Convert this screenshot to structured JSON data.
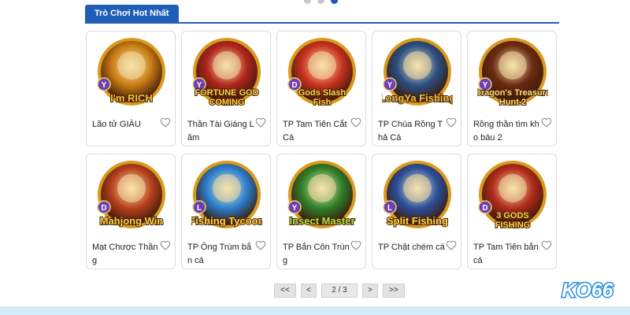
{
  "carousel": {
    "dots": 3,
    "active": 2
  },
  "section": {
    "title": "Trò Chơi Hot Nhất"
  },
  "games": [
    {
      "name": "Lão tử GIÀU",
      "art": "I'm RICH",
      "badge": "Y",
      "color": "#f2c33a",
      "bg": "#c77a12"
    },
    {
      "name": "Thần Tài Giáng Lâm",
      "art": "FORTUNE GOD COMING",
      "badge": "Y",
      "color": "#ffd84a",
      "bg": "#b0251c"
    },
    {
      "name": "TP Tam Tiên Cắt Cá",
      "art": "Gods Slash Fish",
      "badge": "D",
      "color": "#ffd84a",
      "bg": "#c9321e"
    },
    {
      "name": "TP Chúa Rồng Thả Cá",
      "art": "LongYa Fishing",
      "badge": "Y",
      "color": "#e9c24a",
      "bg": "#2c4f84"
    },
    {
      "name": "Rồng thần tìm kho báu 2",
      "art": "Dragon's Treasure Hunt 2",
      "badge": "Y",
      "color": "#ffe27a",
      "bg": "#6b2a12"
    },
    {
      "name": "Mạt Chược Thần g",
      "art": "Mahjong Win",
      "badge": "D",
      "color": "#f7d246",
      "bg": "#b7401c"
    },
    {
      "name": "TP Ông Trùm bắn cá",
      "art": "Fishing Tycoon",
      "badge": "L",
      "color": "#ffd84a",
      "bg": "#2a7fd0"
    },
    {
      "name": "TP Bắn Côn Trùng",
      "art": "Insect Master",
      "badge": "Y",
      "color": "#a7e24a",
      "bg": "#2f7f2b"
    },
    {
      "name": "TP Chặt chém cá",
      "art": "Split Fishing",
      "badge": "L",
      "color": "#ffd84a",
      "bg": "#2b4f9d"
    },
    {
      "name": "TP Tam Tiên bắn cá",
      "art": "3 GODS FISHING",
      "badge": "D",
      "color": "#ffd84a",
      "bg": "#b12b1c"
    }
  ],
  "pagination": {
    "first": "<<",
    "prev": "<",
    "current": "2 / 3",
    "next": ">",
    "last": ">>"
  },
  "brand": {
    "logo": "KO66"
  }
}
